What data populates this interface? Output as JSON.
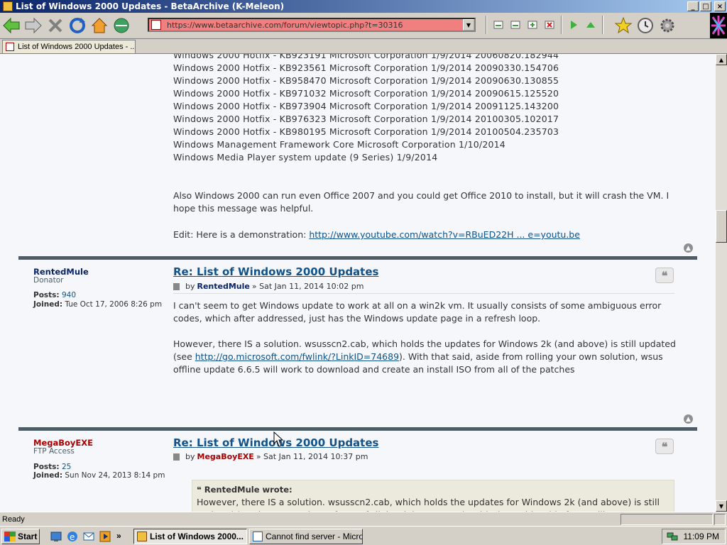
{
  "window": {
    "title": "List of Windows 2000 Updates - BetaArchive (K-Meleon)",
    "btn_min": "_",
    "btn_max": "□",
    "btn_close": "×"
  },
  "toolbar": {
    "url": "https://www.betaarchive.com/forum/viewtopic.php?t=30316",
    "dropdown_arrow": "▼"
  },
  "tab": {
    "label": "List of Windows 2000 Updates - ..."
  },
  "post1": {
    "lines": [
      "Windows 2000 Hotfix - KB923191 Microsoft Corporation 1/9/2014 20060820.182944",
      "Windows 2000 Hotfix - KB923561 Microsoft Corporation 1/9/2014 20090330.154706",
      "Windows 2000 Hotfix - KB958470 Microsoft Corporation 1/9/2014 20090630.130855",
      "Windows 2000 Hotfix - KB971032 Microsoft Corporation 1/9/2014 20090615.125520",
      "Windows 2000 Hotfix - KB973904 Microsoft Corporation 1/9/2014 20091125.143200",
      "Windows 2000 Hotfix - KB976323 Microsoft Corporation 1/9/2014 20100305.102017",
      "Windows 2000 Hotfix - KB980195 Microsoft Corporation 1/9/2014 20100504.235703",
      "Windows Management Framework Core Microsoft Corporation 1/10/2014",
      "Windows Media Player system update (9 Series) 1/9/2014"
    ],
    "para1": "Also Windows 2000 can run even Office 2007 and you could get Office 2010 to install, but it will crash the VM. I hope this message was helpful.",
    "edit_prefix": "Edit: Here is a demonstration: ",
    "edit_link": "http://www.youtube.com/watch?v=RBuED22H ... e=youtu.be"
  },
  "post2": {
    "username": "RentedMule",
    "rank": "Donator",
    "posts_label": "Posts:",
    "posts": "940",
    "joined_label": "Joined:",
    "joined": "Tue Oct 17, 2006 8:26 pm",
    "title": "Re: List of Windows 2000 Updates",
    "by": "by",
    "author": "RentedMule",
    "date": "» Sat Jan 11, 2014 10:02 pm",
    "para1": "I can't seem to get Windows update to work at all on a win2k vm. It usually consists of some ambiguous error codes, which after addressed, just has the Windows update page in a refresh loop.",
    "para2_a": "However, there IS a solution. wsusscn2.cab, which holds the updates for Windows 2k (and above) is still updated (see ",
    "para2_link": "http://go.microsoft.com/fwlink/?LinkID=74689",
    "para2_b": "). With that said, aside from rolling your own solution, wsus offline update 6.6.5 will work to download and create an install ISO from all of the patches"
  },
  "post3": {
    "username": "MegaBoyEXE",
    "rank": "FTP Access",
    "posts_label": "Posts:",
    "posts": "25",
    "joined_label": "Joined:",
    "joined": "Sun Nov 24, 2013 8:14 pm",
    "title": "Re: List of Windows 2000 Updates",
    "by": "by",
    "author": "MegaBoyEXE",
    "date": "» Sat Jan 11, 2014 10:37 pm",
    "quote_header": "RentedMule wrote:",
    "quote_text": "However, there IS a solution. wsusscn2.cab, which holds the updates for Windows 2k (and above) is still updated (see http://go.microsoft.com/fwlink/?LinkID=74689). With that said, aside from rolling your own"
  },
  "status": {
    "text": "Ready"
  },
  "taskbar": {
    "start": "Start",
    "task1": "List of Windows 2000...",
    "task2": "Cannot find server - Micros...",
    "clock": "11:09 PM",
    "chevron": "»"
  },
  "icons": {
    "quote": "❝",
    "top": "▲"
  },
  "colors": {
    "titlebar": "#0a246a",
    "url_bg": "#f08080",
    "link": "#105289",
    "mod_user": "#aa0000",
    "user": "#0a246a",
    "divider": "#4c5d66"
  }
}
